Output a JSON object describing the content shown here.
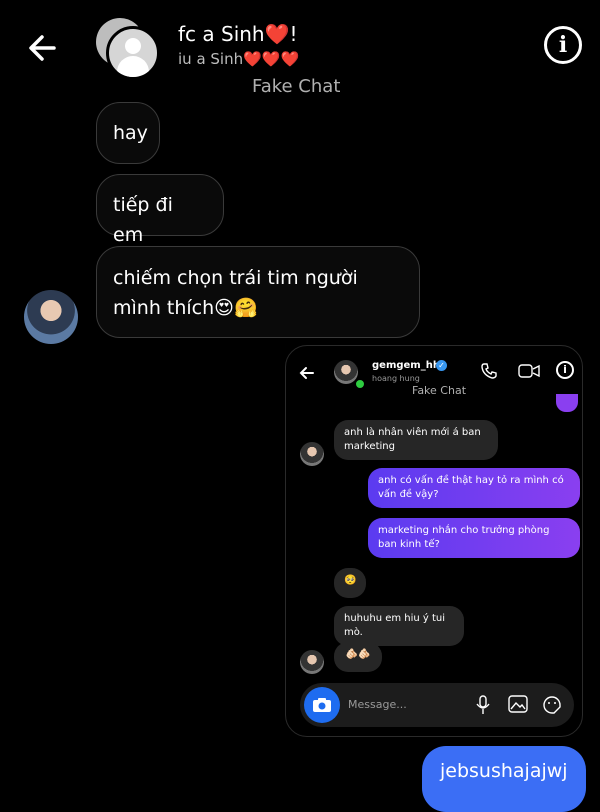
{
  "header": {
    "title": "fc a Sinh❤️!",
    "subtitle": "iu a Sinh❤️❤️❤️",
    "watermark": "Fake Chat"
  },
  "messages": [
    {
      "text": "hay"
    },
    {
      "text": "tiếp đi em"
    },
    {
      "text": "chiếm chọn trái tim người"
    },
    {
      "text": "mình thích😍🤗"
    }
  ],
  "inner_chat": {
    "username": "gemgem_hhh",
    "subname": "hoang hung",
    "watermark": "Fake Chat",
    "messages": [
      {
        "text": "anh là nhân viên mới á ban marketing",
        "from": "them"
      },
      {
        "text": "anh có vấn đề thật hay tỏ ra mình có vấn đề vậy?",
        "from": "me"
      },
      {
        "text": "marketing nhắn cho trưởng phòng ban kinh tế?",
        "from": "me"
      },
      {
        "text": "🥺",
        "from": "them"
      },
      {
        "text": "huhuhu em hiu ý tui mò.",
        "from": "them"
      },
      {
        "text": "🫵🏻🫵🏻",
        "from": "them"
      }
    ],
    "composer_placeholder": "Message..."
  },
  "outgoing": {
    "text": "jebsushajajwj"
  },
  "colors": {
    "outgoing_bubble": "#3b6ef5",
    "inner_me_bubble": "#6a3cf0",
    "camera_button": "#1e6cf0"
  }
}
